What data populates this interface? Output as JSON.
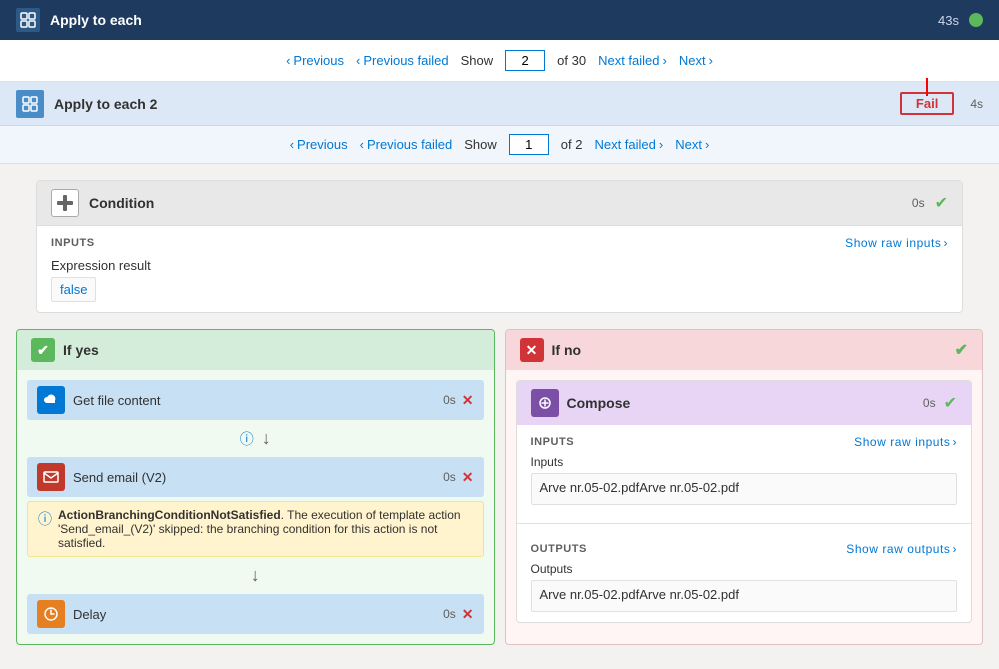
{
  "topBar": {
    "title": "Apply to each",
    "time": "43s",
    "iconUnicode": "⟳"
  },
  "outerNav": {
    "previous": "Previous",
    "previousFailed": "Previous failed",
    "showLabel": "Show",
    "showValue": "2",
    "ofTotal": "of 30",
    "nextFailed": "Next failed",
    "next": "Next"
  },
  "applyToEach2": {
    "title": "Apply to each 2",
    "time": "4s",
    "failBadge": "Fail"
  },
  "innerNav": {
    "previous": "Previous",
    "previousFailed": "Previous failed",
    "showLabel": "Show",
    "showValue": "1",
    "ofTotal": "of 2",
    "nextFailed": "Next failed",
    "next": "Next"
  },
  "condition": {
    "title": "Condition",
    "time": "0s",
    "inputsLabel": "INPUTS",
    "showRawInputs": "Show raw inputs",
    "expressionResultLabel": "Expression result",
    "expressionResultValue": "false"
  },
  "ifYes": {
    "title": "If yes",
    "getFileContent": {
      "label": "Get file content",
      "time": "0s"
    },
    "sendEmail": {
      "label": "Send email (V2)",
      "time": "0s",
      "warningBold": "ActionBranchingConditionNotSatisfied",
      "warningText": ". The execution of template action 'Send_email_(V2)' skipped: the branching condition for this action is not satisfied."
    },
    "delay": {
      "label": "Delay",
      "time": "0s"
    }
  },
  "ifNo": {
    "title": "If no",
    "compose": {
      "title": "Compose",
      "time": "0s",
      "inputsLabel": "INPUTS",
      "showRawInputs": "Show raw inputs",
      "inputsSubLabel": "Inputs",
      "inputsValue": "Arve nr.05-02.pdfArve nr.05-02.pdf",
      "outputsLabel": "OUTPUTS",
      "showRawOutputs": "Show raw outputs",
      "outputsSubLabel": "Outputs",
      "outputsValue": "Arve nr.05-02.pdfArve nr.05-02.pdf"
    }
  },
  "colors": {
    "accent": "#0078d4",
    "success": "#5cb85c",
    "fail": "#d13438",
    "topBarBg": "#1f3a5f"
  }
}
